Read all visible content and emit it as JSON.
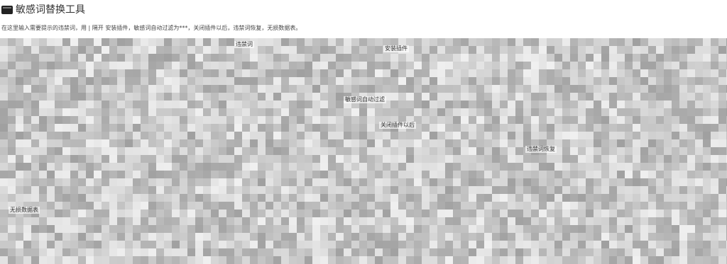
{
  "header": {
    "icon": "terminal-window-icon",
    "title": "敏感词替换工具"
  },
  "description": "在这里输入需要提示的违禁词，用 | 隔开 安装插件，敏感词自动过滤为***，关闭插件以后，违禁词恢复，无损数据表。",
  "editor": {
    "content": "pixelated-mosaic",
    "colors": {
      "base": "#c8c8c8",
      "light": "#e6e6e6",
      "dark": "#9a9a9a"
    },
    "visible_fragments": [
      "敏感词替换工具",
      "违禁词",
      "安装插件",
      "敏感词自动过滤",
      "关闭插件以后",
      "违禁词恢复",
      "无损数据表"
    ]
  }
}
